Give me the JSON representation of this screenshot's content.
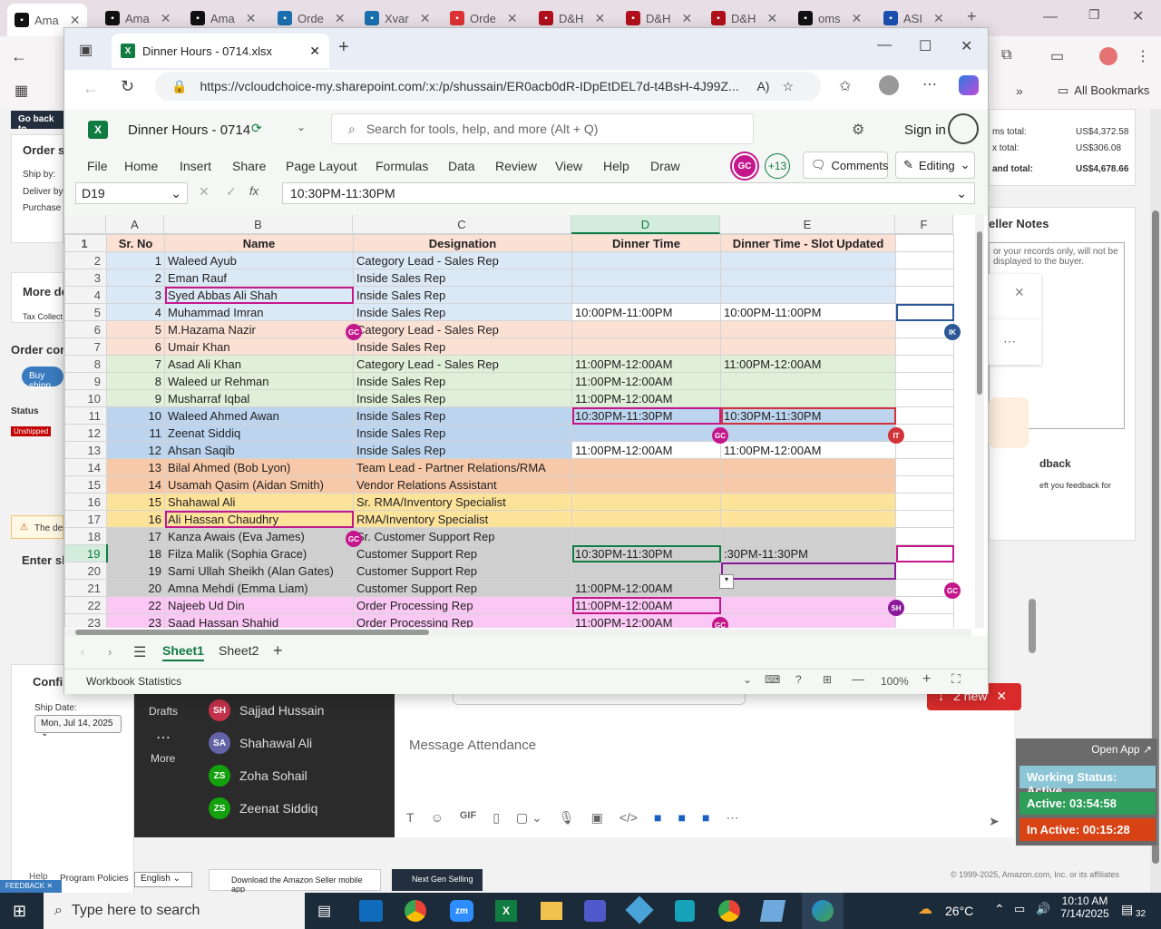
{
  "outer_tabs": [
    {
      "label": "Ama",
      "icon": "amazon-icon",
      "color": "#111"
    },
    {
      "label": "Ama",
      "icon": "amazon-icon",
      "color": "#111"
    },
    {
      "label": "Ama",
      "icon": "amazon-icon",
      "color": "#111"
    },
    {
      "label": "Orde",
      "icon": "ec-icon",
      "color": "#1a6fb0"
    },
    {
      "label": "Xvar",
      "icon": "xvar-icon",
      "color": "#1a6fb0"
    },
    {
      "label": "Orde",
      "icon": "order-icon",
      "color": "#d33"
    },
    {
      "label": "D&H",
      "icon": "dh-icon",
      "color": "#b0101c"
    },
    {
      "label": "D&H",
      "icon": "dh-icon",
      "color": "#b0101c"
    },
    {
      "label": "D&H",
      "icon": "dh-icon",
      "color": "#b0101c"
    },
    {
      "label": "oms",
      "icon": "oms-icon",
      "color": "#111"
    },
    {
      "label": "ASI",
      "icon": "asi-icon",
      "color": "#1a4fb0"
    }
  ],
  "outer_toolbar": {
    "all_bookmarks": "All Bookmarks"
  },
  "bg_page": {
    "go_back": "Go back to",
    "order_summary": "Order su",
    "ship_by": "Ship by:",
    "deliver_by": "Deliver by:",
    "purchase": "Purchase d",
    "more_details": "More de",
    "tax_collect": "Tax Collect",
    "order_contents": "Order cont",
    "buy_shipping": "Buy shipp",
    "status_label": "Status",
    "unshipped": "Unshipped",
    "the_desc": "The des",
    "enter_sh": "Enter sh",
    "confirm": "Confir",
    "ship_date_label": "Ship Date:",
    "ship_date": "Mon, Jul 14, 2025",
    "items_total_label": "ms total:",
    "items_total": "US$4,372.58",
    "tax_total_label": "x total:",
    "tax_total": "US$306.08",
    "grand_total_label": "and total:",
    "grand_total": "US$4,678.66",
    "seller_notes": "eller Notes",
    "seller_notes_hint": "or your records only, will not be displayed to the buyer.",
    "feedback_title": "dback",
    "feedback_text": "eft you feedback for",
    "footer_help": "Help",
    "program_policies": "Program Policies",
    "language": "English",
    "download_app": "Download the Amazon Seller mobile app",
    "next_gen": "Next Gen Selling",
    "copyright": "© 1999-2025, Amazon.com, Inc. or its affiliates",
    "feedback_tag": "FEEDBACK"
  },
  "edge": {
    "tab_title": "Dinner Hours - 0714.xlsx",
    "url": "https://vcloudchoice-my.sharepoint.com/:x:/p/shussain/ER0acb0dR-IDpEtDEL7d-t4BsH-4J99Z..."
  },
  "excel": {
    "file_name": "Dinner Hours - 0714",
    "search_placeholder": "Search for tools, help, and more (Alt + Q)",
    "sign_in": "Sign in",
    "menus": [
      "File",
      "Home",
      "Insert",
      "Share",
      "Page Layout",
      "Formulas",
      "Data",
      "Review",
      "View",
      "Help",
      "Draw"
    ],
    "collab_initials": "GC",
    "collab_count": "+13",
    "comments": "Comments",
    "editing": "Editing",
    "name_box": "D19",
    "formula": "10:30PM-11:30PM",
    "columns": [
      "A",
      "B",
      "C",
      "D",
      "E",
      "F"
    ],
    "headers": [
      "Sr. No",
      "Name",
      "Designation",
      "Dinner Time",
      "Dinner Time - Slot Updated"
    ],
    "rows": [
      {
        "r": "2",
        "sr": "1",
        "name": "Waleed Ayub",
        "des": "Category Lead - Sales Rep",
        "d": "",
        "e": "",
        "bg": "#dbe8f5"
      },
      {
        "r": "3",
        "sr": "2",
        "name": "Eman Rauf",
        "des": "Inside Sales Rep",
        "d": "",
        "e": "",
        "bg": "#dbe8f5"
      },
      {
        "r": "4",
        "sr": "3",
        "name": "Syed Abbas Ali Shah",
        "des": "Inside Sales Rep",
        "d": "",
        "e": "",
        "bg": "#dbe8f5"
      },
      {
        "r": "5",
        "sr": "4",
        "name": "Muhammad Imran",
        "des": "Inside Sales Rep",
        "d": "10:00PM-11:00PM",
        "e": "10:00PM-11:00PM",
        "bg": "#dbe8f5"
      },
      {
        "r": "6",
        "sr": "5",
        "name": "M.Hazama Nazir",
        "des": "Category Lead - Sales Rep",
        "d": "",
        "e": "",
        "bg": "#fbe0d4"
      },
      {
        "r": "7",
        "sr": "6",
        "name": "Umair Khan",
        "des": "Inside Sales Rep",
        "d": "",
        "e": "",
        "bg": "#fbe0d4"
      },
      {
        "r": "8",
        "sr": "7",
        "name": "Asad Ali Khan",
        "des": "Category Lead - Sales Rep",
        "d": "11:00PM-12:00AM",
        "e": "11:00PM-12:00AM",
        "bg": "#e0efd8"
      },
      {
        "r": "9",
        "sr": "8",
        "name": "Waleed ur Rehman",
        "des": "Inside Sales Rep",
        "d": "11:00PM-12:00AM",
        "e": "",
        "bg": "#e0efd8"
      },
      {
        "r": "10",
        "sr": "9",
        "name": "Musharraf Iqbal",
        "des": "Inside Sales Rep",
        "d": "11:00PM-12:00AM",
        "e": "",
        "bg": "#e0efd8"
      },
      {
        "r": "11",
        "sr": "10",
        "name": "Waleed Ahmed Awan",
        "des": "Inside Sales Rep",
        "d": "10:30PM-11:30PM",
        "e": "10:30PM-11:30PM",
        "bg": "#bcd4ee"
      },
      {
        "r": "12",
        "sr": "11",
        "name": "Zeenat Siddiq",
        "des": "Inside Sales Rep",
        "d": "",
        "e": "",
        "bg": "#bcd4ee"
      },
      {
        "r": "13",
        "sr": "12",
        "name": "Ahsan Saqib",
        "des": "Inside Sales Rep",
        "d": "11:00PM-12:00AM",
        "e": "11:00PM-12:00AM",
        "bg": "#bcd4ee"
      },
      {
        "r": "14",
        "sr": "13",
        "name": "Bilal Ahmed (Bob Lyon)",
        "des": "Team Lead - Partner Relations/RMA",
        "d": "",
        "e": "",
        "bg": "#f8c9a8"
      },
      {
        "r": "15",
        "sr": "14",
        "name": "Usamah Qasim (Aidan Smith)",
        "des": "Vendor Relations Assistant",
        "d": "",
        "e": "",
        "bg": "#f8c9a8"
      },
      {
        "r": "16",
        "sr": "15",
        "name": "Shahawal Ali",
        "des": "Sr. RMA/Inventory Specialist",
        "d": "",
        "e": "",
        "bg": "#fde29a"
      },
      {
        "r": "17",
        "sr": "16",
        "name": "Ali Hassan Chaudhry",
        "des": "RMA/Inventory Specialist",
        "d": "",
        "e": "",
        "bg": "#fde29a"
      },
      {
        "r": "18",
        "sr": "17",
        "name": "Kanza Awais (Eva James)",
        "des": "Sr. Customer Support Rep",
        "d": "",
        "e": "",
        "bg": "#cfcfcf"
      },
      {
        "r": "19",
        "sr": "18",
        "name": "Filza Malik (Sophia Grace)",
        "des": "Customer Support Rep",
        "d": "10:30PM-11:30PM",
        "e": ":30PM-11:30PM",
        "bg": "#cfcfcf"
      },
      {
        "r": "20",
        "sr": "19",
        "name": "Sami Ullah Sheikh (Alan Gates)",
        "des": "Customer Support Rep",
        "d": "",
        "e": "",
        "bg": "#cfcfcf"
      },
      {
        "r": "21",
        "sr": "20",
        "name": "Amna Mehdi (Emma Liam)",
        "des": "Customer Support Rep",
        "d": "11:00PM-12:00AM",
        "e": "",
        "bg": "#cfcfcf"
      },
      {
        "r": "22",
        "sr": "22",
        "name": "Najeeb Ud Din",
        "des": "Order Processing Rep",
        "d": "11:00PM-12:00AM",
        "e": "",
        "bg": "#fbc8f5"
      },
      {
        "r": "23",
        "sr": "23",
        "name": "Saad Hassan Shahid",
        "des": "Order Processing Rep",
        "d": "11:00PM-12:00AM",
        "e": "",
        "bg": "#fbc8f5"
      }
    ],
    "sheet_tabs": [
      "Sheet1",
      "Sheet2"
    ],
    "workbook_stats": "Workbook Statistics",
    "zoom": "100%"
  },
  "presence": {
    "gc": "GC",
    "it": "IT",
    "ik": "IK",
    "sh": "SH"
  },
  "teams": {
    "drafts": "Drafts",
    "more": "More",
    "people": [
      {
        "initials": "SH",
        "name": "Sajjad Hussain",
        "color": "#c4314b"
      },
      {
        "initials": "SA",
        "name": "Shahawal Ali",
        "color": "#6264a7"
      },
      {
        "initials": "ZS",
        "name": "Zoha Sohail",
        "color": "#13a10e"
      },
      {
        "initials": "ZS",
        "name": "Zeenat Siddiq",
        "color": "#13a10e"
      }
    ],
    "message_placeholder": "Message Attendance",
    "new_count": "2 new"
  },
  "work_status": {
    "open_app": "Open App",
    "status": "Working Status: Active",
    "active": "Active: 03:54:58",
    "inactive": "In Active: 00:15:28"
  },
  "taskbar": {
    "search": "Type here to search",
    "temp": "26°C",
    "time": "10:10 AM",
    "date": "7/14/2025",
    "notifications": "32"
  }
}
